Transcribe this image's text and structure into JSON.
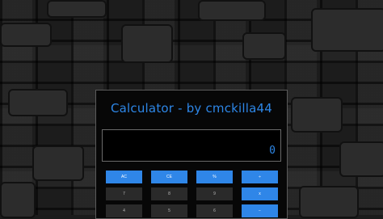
{
  "app": {
    "title": "Calculator - by cmckilla44"
  },
  "display": {
    "value": "0"
  },
  "keys": {
    "row1": [
      "AC",
      "CE",
      "%",
      "÷"
    ],
    "row2": [
      "7",
      "8",
      "9",
      "x"
    ],
    "row3": [
      "4",
      "5",
      "6",
      "−"
    ]
  },
  "colors": {
    "accent": "#2f86e8",
    "key_grey": "#2a2a2a",
    "panel": "#070707"
  }
}
